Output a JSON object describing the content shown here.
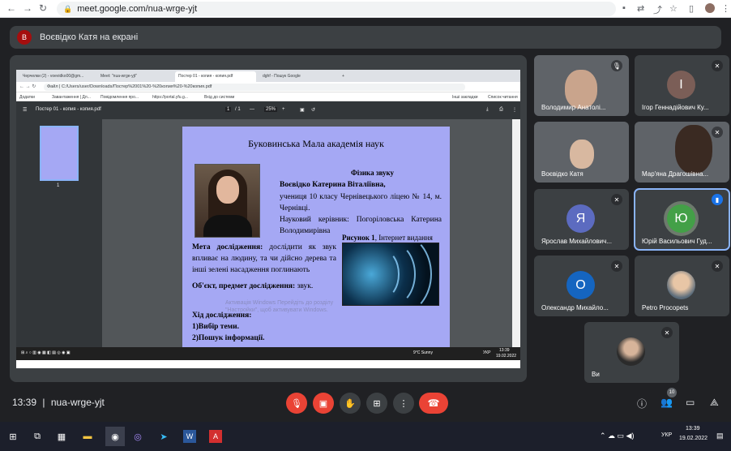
{
  "browser": {
    "url": "meet.google.com/nua-wrge-yjt"
  },
  "banner": {
    "avatar_letter": "В",
    "text": "Воєвідко Катя на екрані"
  },
  "inner_browser": {
    "tabs": [
      "Черчелки (2) - voevidko00@gm...",
      "Meet: \"nua-wrge-yjt\"",
      "Постер 01 - копия - копия.pdf",
      "dghf - Пошук Google"
    ],
    "address": "Файл | C:/Users/user/Downloads/Постер%2001%20-%20копия%20-%20копия.pdf",
    "bookmarks": [
      "Додатки",
      "Завантаження | Дл...",
      "Повідомлення про...",
      "https://portal.yfu.g...",
      "Вхід до системи",
      "Інші закладки",
      "Список читання"
    ]
  },
  "pdf": {
    "filename": "Постер 01 - копия - копия.pdf",
    "page": "1",
    "pages": "/ 1",
    "zoom": "25%",
    "thumb_number": "1"
  },
  "poster": {
    "title": "Буковинська Мала академія наук",
    "subtitle": "Фізика звуку",
    "author": "Воєвідко Катерина Віталіївна,",
    "author_rest": "учениця 10 класу Чернівецького ліцею № 14, м. Чернівці.",
    "supervisor": "Науковий керівник: Погоріловська Катерина Володимирівна",
    "figure_caption_bold": "Рисунок 1",
    "figure_caption": ", Інтернет видання",
    "goal_label": "Мета дослідження:",
    "goal_text": "дослідити як звук впливає на людину, та чи дійсно дерева та інші зелені насадження поглинають",
    "object_label": "Об'єкт, предмет дослідження:",
    "object_text": "звук.",
    "progress_label": "Хід дослідження:",
    "step1": "1)Вибір теми.",
    "step2": "2)Пошук інформації.",
    "watermark": "Активація Windows Перейдіть до розділу \"Настройки\", щоб активувати Windows."
  },
  "inner_taskbar": {
    "weather": "9°C Sunny",
    "lang": "УКР",
    "time": "13:39",
    "date": "19.02.2022"
  },
  "participants": [
    {
      "name": "Володимир Анатолі...",
      "kind": "video"
    },
    {
      "name": "Ігор Геннадійович Ку...",
      "initial": "І",
      "color": "#7b5e57"
    },
    {
      "name": "Воєвідко Катя",
      "kind": "video"
    },
    {
      "name": "Мар'яна Драгошівна...",
      "kind": "video"
    },
    {
      "name": "Ярослав Михайлович...",
      "initial": "Я",
      "color": "#5c6bc0"
    },
    {
      "name": "Юрій Васильович Гуд...",
      "initial": "Ю",
      "color": "#43a047"
    },
    {
      "name": "Олександр Михайло...",
      "initial": "О",
      "color": "#1565c0"
    },
    {
      "name": "Petro Procopets",
      "kind": "photo"
    },
    {
      "name": "Ви",
      "kind": "photo"
    }
  ],
  "bottom": {
    "time": "13:39",
    "separator": "|",
    "code": "nua-wrge-yjt",
    "people_count": "10"
  },
  "taskbar": {
    "lang": "УКР",
    "time": "13:39",
    "date": "19.02.2022"
  }
}
